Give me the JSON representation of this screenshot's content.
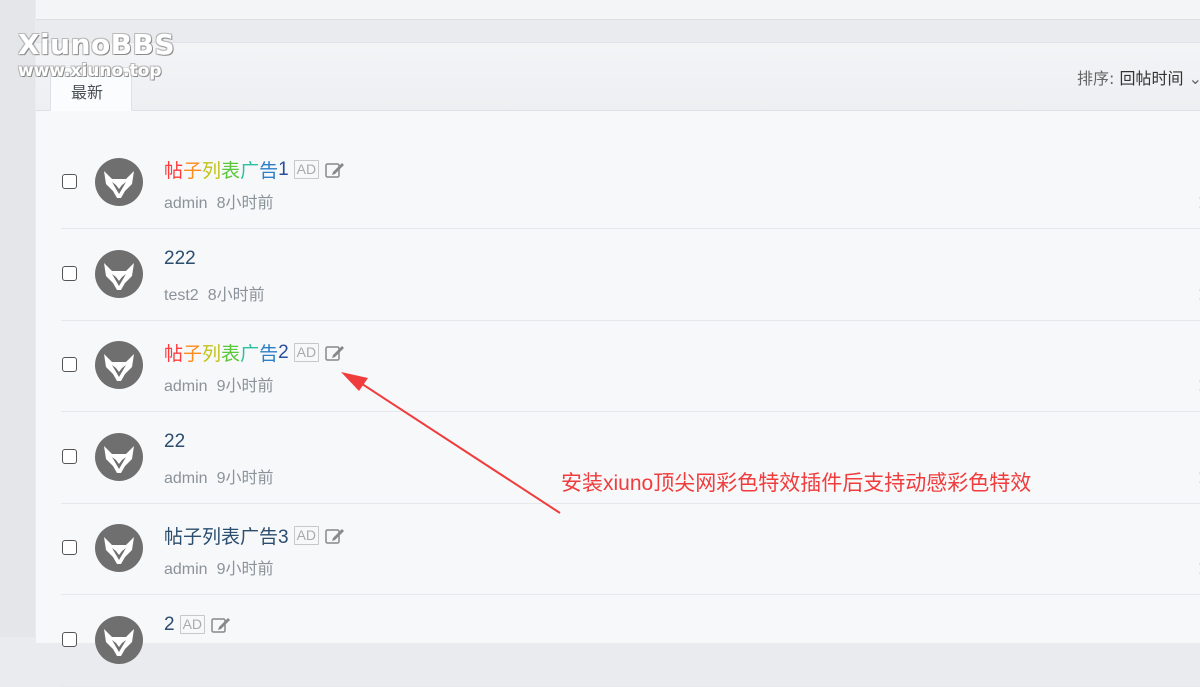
{
  "watermark": {
    "title": "XiunoBBS",
    "url": "www.xiuno.top"
  },
  "tabs": [
    {
      "label": "最新"
    }
  ],
  "sort": {
    "label": "排序:",
    "value": "回帖时间"
  },
  "threads": [
    {
      "title_segments": [
        "帖",
        "子",
        "列",
        "表",
        "广",
        "告",
        "1"
      ],
      "colorful": true,
      "ad": "AD",
      "user": "admin",
      "time": "8小时前"
    },
    {
      "title_segments": [
        "222"
      ],
      "colorful": false,
      "ad": "",
      "user": "test2",
      "time": "8小时前"
    },
    {
      "title_segments": [
        "帖",
        "子",
        "列",
        "表",
        "广",
        "告",
        "2"
      ],
      "colorful": true,
      "ad": "AD",
      "user": "admin",
      "time": "9小时前"
    },
    {
      "title_segments": [
        "22"
      ],
      "colorful": false,
      "ad": "",
      "user": "admin",
      "time": "9小时前"
    },
    {
      "title_segments": [
        "帖子列表广告3"
      ],
      "colorful": false,
      "ad": "AD",
      "user": "admin",
      "time": "9小时前"
    },
    {
      "title_segments": [
        "2"
      ],
      "colorful": false,
      "ad": "AD",
      "user": "",
      "time": ""
    }
  ],
  "annotation": "安装xiuno顶尖网彩色特效插件后支持动感彩色特效",
  "colors": {
    "accent_red": "#f03c3c",
    "link_blue": "#2b4d6e"
  }
}
